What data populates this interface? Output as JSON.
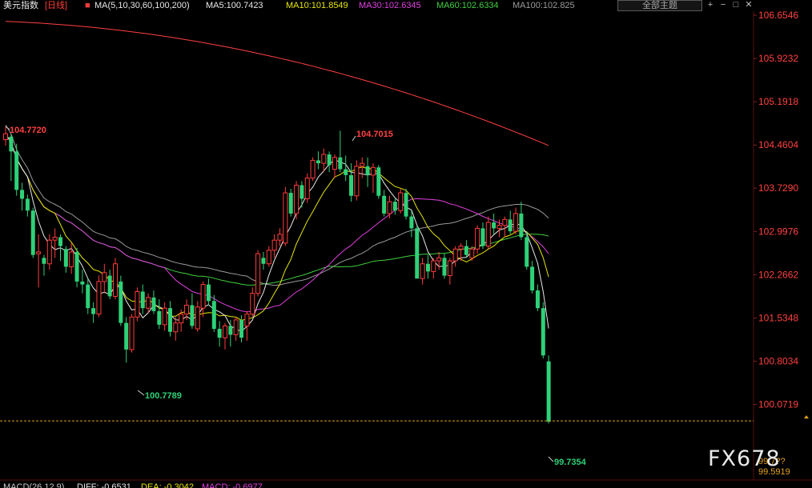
{
  "header": {
    "instrument": "美元指数",
    "period": "[日线]",
    "ma_params": "MA(5,10,30,60,100,200)",
    "ma_values": [
      {
        "text": "MA5:100.7423",
        "color": "#e8e8e8"
      },
      {
        "text": "MA10:101.8549",
        "color": "#e6e600"
      },
      {
        "text": "MA30:102.6345",
        "color": "#e040e0"
      },
      {
        "text": "MA60:102.6334",
        "color": "#40d040"
      },
      {
        "text": "MA100:102.825",
        "color": "#9a9a9a"
      }
    ],
    "theme_select": "全部主题",
    "buttons": [
      "+",
      "−",
      "□"
    ]
  },
  "price_axis": [
    "106.6546",
    "105.9232",
    "105.1918",
    "104.4604",
    "103.7290",
    "102.9976",
    "102.2662",
    "101.5348",
    "100.8034",
    "100.0719"
  ],
  "price_tags": {
    "upper": "99.7??",
    "lower": "99.5919"
  },
  "annotations": {
    "high_left": "104.7720",
    "high_mid": "104.7015",
    "low_mid": "100.7789",
    "low_last": "99.7354"
  },
  "bottom": {
    "macd": "MACD(26,12,9)",
    "dif": "DIFF: -0.6531",
    "dea": "DEA: -0.3042",
    "macd_val": "MACD: -0.6977"
  },
  "watermark": "FX678",
  "colors": {
    "up": "#ff3c3c",
    "down": "#2ed178",
    "ma100": "#ff4040",
    "current_price_line": "#e5a020"
  },
  "chart_data": {
    "type": "candlestick",
    "ylim": [
      99.5919,
      106.6546
    ],
    "candles": [
      [
        104.55,
        104.77,
        104.45,
        104.65
      ],
      [
        104.6,
        104.65,
        103.85,
        104.35
      ],
      [
        104.35,
        104.48,
        103.6,
        103.7
      ],
      [
        103.7,
        103.82,
        103.35,
        103.55
      ],
      [
        103.55,
        103.62,
        103.25,
        103.35
      ],
      [
        103.35,
        103.4,
        102.55,
        102.6
      ],
      [
        102.62,
        102.95,
        102.05,
        102.65
      ],
      [
        102.55,
        102.6,
        102.25,
        102.45
      ],
      [
        102.45,
        102.95,
        102.35,
        102.85
      ],
      [
        102.85,
        103.05,
        102.55,
        102.9
      ],
      [
        102.9,
        102.95,
        102.5,
        102.75
      ],
      [
        102.7,
        102.75,
        102.3,
        102.4
      ],
      [
        102.4,
        102.8,
        102.28,
        102.65
      ],
      [
        102.65,
        102.72,
        102.05,
        102.15
      ],
      [
        102.15,
        102.35,
        101.95,
        102.1
      ],
      [
        102.1,
        102.2,
        101.6,
        101.7
      ],
      [
        101.7,
        101.8,
        101.45,
        101.6
      ],
      [
        101.6,
        102.25,
        101.55,
        102.15
      ],
      [
        102.15,
        102.45,
        101.95,
        102.3
      ],
      [
        102.25,
        102.35,
        101.85,
        101.9
      ],
      [
        101.9,
        102.55,
        101.85,
        102.45
      ],
      [
        102.15,
        102.25,
        101.4,
        101.45
      ],
      [
        101.45,
        101.55,
        100.78,
        101.0
      ],
      [
        101.0,
        101.6,
        100.95,
        101.55
      ],
      [
        101.55,
        102.05,
        101.48,
        101.98
      ],
      [
        101.98,
        102.1,
        101.6,
        101.7
      ],
      [
        101.7,
        101.95,
        101.62,
        101.88
      ],
      [
        101.88,
        102.0,
        101.6,
        101.65
      ],
      [
        101.65,
        101.85,
        101.35,
        101.42
      ],
      [
        101.42,
        101.8,
        101.32,
        101.7
      ],
      [
        101.7,
        101.82,
        101.22,
        101.3
      ],
      [
        101.3,
        101.55,
        101.15,
        101.45
      ],
      [
        101.45,
        101.68,
        101.3,
        101.6
      ],
      [
        101.6,
        101.85,
        101.5,
        101.75
      ],
      [
        101.75,
        101.95,
        101.35,
        101.4
      ],
      [
        101.35,
        101.82,
        101.3,
        101.72
      ],
      [
        101.7,
        102.15,
        101.55,
        102.1
      ],
      [
        102.1,
        102.2,
        101.75,
        101.82
      ],
      [
        101.82,
        101.92,
        101.3,
        101.35
      ],
      [
        101.35,
        101.48,
        101.05,
        101.2
      ],
      [
        101.2,
        101.45,
        101.0,
        101.4
      ],
      [
        101.4,
        101.5,
        101.05,
        101.25
      ],
      [
        101.25,
        101.55,
        101.15,
        101.5
      ],
      [
        101.5,
        101.58,
        101.12,
        101.2
      ],
      [
        101.4,
        101.65,
        101.15,
        101.6
      ],
      [
        101.6,
        102.05,
        101.55,
        101.95
      ],
      [
        101.95,
        102.68,
        101.9,
        102.62
      ],
      [
        102.55,
        102.65,
        102.35,
        102.45
      ],
      [
        102.45,
        102.75,
        102.4,
        102.68
      ],
      [
        102.68,
        102.95,
        102.55,
        102.85
      ],
      [
        102.85,
        103.05,
        102.75,
        102.95
      ],
      [
        102.8,
        103.75,
        102.75,
        103.65
      ],
      [
        103.65,
        103.72,
        103.25,
        103.3
      ],
      [
        103.3,
        103.85,
        103.2,
        103.78
      ],
      [
        103.78,
        103.85,
        103.4,
        103.55
      ],
      [
        103.55,
        103.98,
        103.48,
        103.9
      ],
      [
        103.9,
        104.25,
        103.85,
        104.2
      ],
      [
        104.2,
        104.35,
        104.05,
        104.15
      ],
      [
        104.15,
        104.4,
        104.0,
        104.3
      ],
      [
        104.3,
        104.35,
        104.0,
        104.12
      ],
      [
        104.05,
        104.3,
        103.9,
        104.25
      ],
      [
        104.25,
        104.7,
        104.0,
        104.05
      ],
      [
        104.05,
        104.28,
        103.85,
        103.95
      ],
      [
        103.95,
        104.15,
        103.5,
        103.6
      ],
      [
        103.6,
        104.2,
        103.52,
        104.1
      ],
      [
        104.1,
        104.25,
        103.9,
        104.15
      ],
      [
        104.1,
        104.25,
        103.75,
        103.95
      ],
      [
        103.95,
        104.15,
        103.65,
        104.08
      ],
      [
        104.08,
        104.12,
        103.55,
        103.6
      ],
      [
        103.6,
        103.7,
        103.25,
        103.3
      ],
      [
        103.3,
        103.6,
        103.22,
        103.5
      ],
      [
        103.5,
        103.55,
        103.28,
        103.35
      ],
      [
        103.35,
        103.72,
        103.3,
        103.65
      ],
      [
        103.65,
        103.72,
        103.2,
        103.25
      ],
      [
        103.25,
        103.35,
        102.9,
        103.05
      ],
      [
        103.05,
        103.1,
        102.2,
        102.2
      ],
      [
        102.2,
        102.55,
        102.1,
        102.45
      ],
      [
        102.45,
        102.6,
        102.2,
        102.32
      ],
      [
        102.32,
        102.55,
        102.2,
        102.5
      ],
      [
        102.5,
        102.65,
        102.35,
        102.55
      ],
      [
        102.55,
        102.62,
        102.2,
        102.25
      ],
      [
        102.25,
        102.55,
        102.1,
        102.5
      ],
      [
        102.5,
        102.75,
        102.4,
        102.7
      ],
      [
        102.7,
        102.8,
        102.5,
        102.75
      ],
      [
        102.75,
        102.85,
        102.55,
        102.6
      ],
      [
        102.55,
        102.75,
        102.5,
        102.7
      ],
      [
        102.7,
        103.1,
        102.62,
        103.05
      ],
      [
        103.05,
        103.15,
        102.7,
        102.75
      ],
      [
        102.75,
        103.25,
        102.7,
        103.15
      ],
      [
        103.15,
        103.3,
        102.95,
        103.05
      ],
      [
        103.05,
        103.2,
        102.9,
        103.1
      ],
      [
        103.1,
        103.25,
        102.9,
        103.2
      ],
      [
        103.2,
        103.35,
        102.95,
        103.0
      ],
      [
        103.0,
        103.4,
        102.95,
        103.3
      ],
      [
        103.3,
        103.5,
        102.85,
        102.9
      ],
      [
        102.9,
        103.0,
        102.35,
        102.4
      ],
      [
        102.4,
        102.5,
        101.95,
        102.0
      ],
      [
        102.0,
        102.1,
        101.65,
        101.7
      ],
      [
        101.7,
        101.8,
        100.85,
        100.9
      ],
      [
        100.8,
        100.9,
        99.75,
        99.78
      ]
    ]
  }
}
